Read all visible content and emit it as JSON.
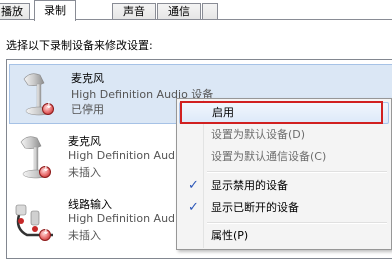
{
  "tabs": [
    "播放",
    "录制",
    "声音",
    "通信",
    ""
  ],
  "instruction": "选择以下录制设备来修改设置:",
  "devices": [
    {
      "name": "麦克风",
      "desc": "High Definition Audio 设备",
      "status": "已停用",
      "icon": "microphone-icon"
    },
    {
      "name": "麦克风",
      "desc": "High Definition Audio",
      "status": "未插入",
      "icon": "microphone-icon"
    },
    {
      "name": "线路输入",
      "desc": "High Definition Audi",
      "status": "未插入",
      "icon": "line-in-icon"
    }
  ],
  "menu": {
    "items": [
      {
        "label": "启用",
        "enabled": true,
        "checked": false
      },
      {
        "label": "设置为默认设备(D)",
        "enabled": false,
        "checked": false
      },
      {
        "label": "设置为默认通信设备(C)",
        "enabled": false,
        "checked": false
      },
      {
        "label": "显示禁用的设备",
        "enabled": true,
        "checked": true
      },
      {
        "label": "显示已断开的设备",
        "enabled": true,
        "checked": true
      },
      {
        "label": "属性(P)",
        "enabled": true,
        "checked": false
      }
    ],
    "check_glyph": "✓"
  },
  "colors": {
    "highlight_box": "#d12020",
    "selection": "#dbe7f5",
    "check": "#2b56b8"
  }
}
